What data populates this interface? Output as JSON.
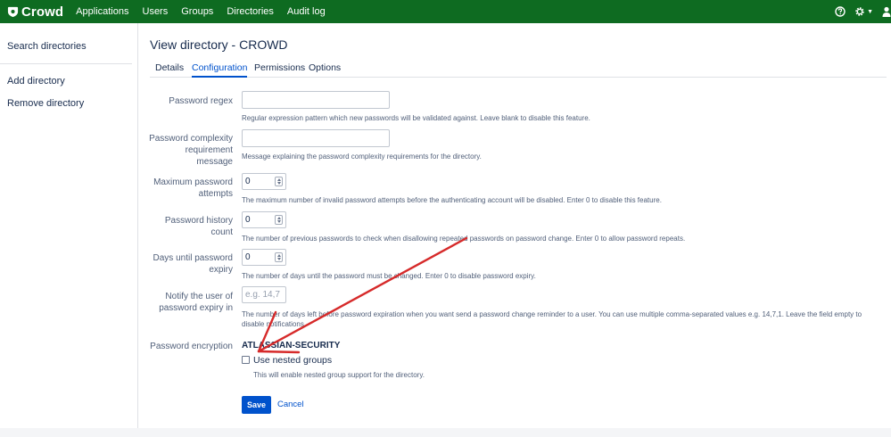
{
  "brand": {
    "name": "Crowd",
    "color": "#0e6b21",
    "accent": "#0052cc"
  },
  "nav": {
    "items": [
      "Applications",
      "Users",
      "Groups",
      "Directories",
      "Audit log"
    ]
  },
  "header_icons": {
    "help": "help-icon",
    "settings": "gear-icon",
    "user": "user-icon"
  },
  "sidebar": {
    "search": "Search directories",
    "add": "Add directory",
    "remove": "Remove directory"
  },
  "page": {
    "title": "View directory - CROWD",
    "tabs": [
      "Details",
      "Configuration",
      "Permissions",
      "Options"
    ],
    "active_tab": "Configuration"
  },
  "form": {
    "password_regex": {
      "label": "Password regex",
      "value": "",
      "help": "Regular expression pattern which new passwords will be validated against. Leave blank to disable this feature."
    },
    "complexity": {
      "label_lines": [
        "Password complexity",
        "requirement",
        "message"
      ],
      "value": "",
      "help": "Message explaining the password complexity requirements for the directory."
    },
    "max_attempts": {
      "label_lines": [
        "Maximum password",
        "attempts"
      ],
      "value": "0",
      "help": "The maximum number of invalid password attempts before the authenticating account will be disabled. Enter 0 to disable this feature."
    },
    "history": {
      "label_lines": [
        "Password history",
        "count"
      ],
      "value": "0",
      "help": "The number of previous passwords to check when disallowing repeated passwords on password change. Enter 0 to allow password repeats."
    },
    "expiry": {
      "label_lines": [
        "Days until password",
        "expiry"
      ],
      "value": "0",
      "help": "The number of days until the password must be changed. Enter 0 to disable password expiry."
    },
    "notify": {
      "label_lines": [
        "Notify the user of",
        "password expiry in"
      ],
      "placeholder": "e.g. 14,7",
      "help": "The number of days left before password expiration when you want send a password change reminder to a user. You can use multiple comma-separated values e.g. 14,7,1. Leave the field empty to disable notifications."
    },
    "encryption": {
      "label": "Password encryption",
      "value": "ATLASSIAN-SECURITY"
    },
    "nested_groups": {
      "label": "Use nested groups",
      "checked": false,
      "help": "This will enable nested group support for the directory."
    },
    "save": "Save",
    "cancel": "Cancel"
  },
  "annotation": {
    "color": "#d62a2a"
  }
}
